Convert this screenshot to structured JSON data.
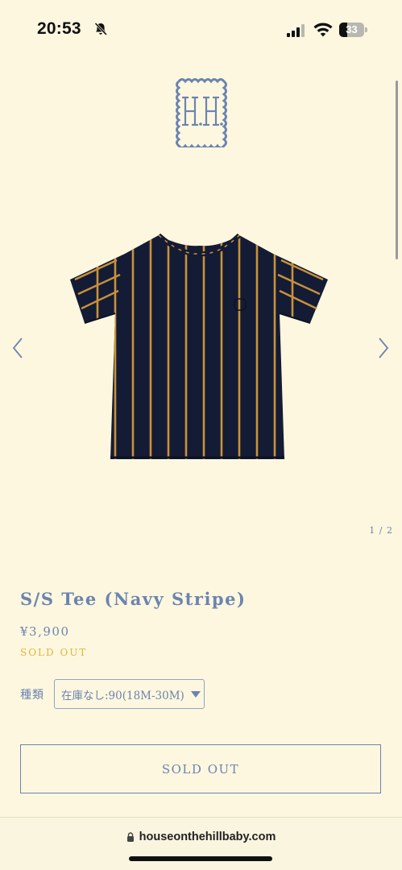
{
  "status_bar": {
    "time": "20:53",
    "battery_level": "33",
    "battery_fraction": 0.33,
    "icons": [
      "bell-slash-icon",
      "cellular-signal-icon",
      "wifi-icon",
      "battery-icon"
    ]
  },
  "brand": {
    "logo_text": "H.H.",
    "logo_icon": "scalloped-monogram-logo",
    "colors": {
      "accent": "#6b84b0",
      "gold": "#e0b43d",
      "background": "#fdf7df"
    }
  },
  "gallery": {
    "prev_icon": "chevron-left-icon",
    "next_icon": "chevron-right-icon",
    "pager": "1 / 2",
    "image_subject": "navy-gold-striped-tshirt"
  },
  "product": {
    "title": "S/S Tee (Navy Stripe)",
    "price": "¥3,900",
    "status": "SOLD OUT",
    "variant_label": "種類",
    "variant_selected": "在庫なし:90(18M-30M)",
    "button_label": "SOLD OUT"
  },
  "browser": {
    "url": "houseonthehillbaby.com"
  }
}
